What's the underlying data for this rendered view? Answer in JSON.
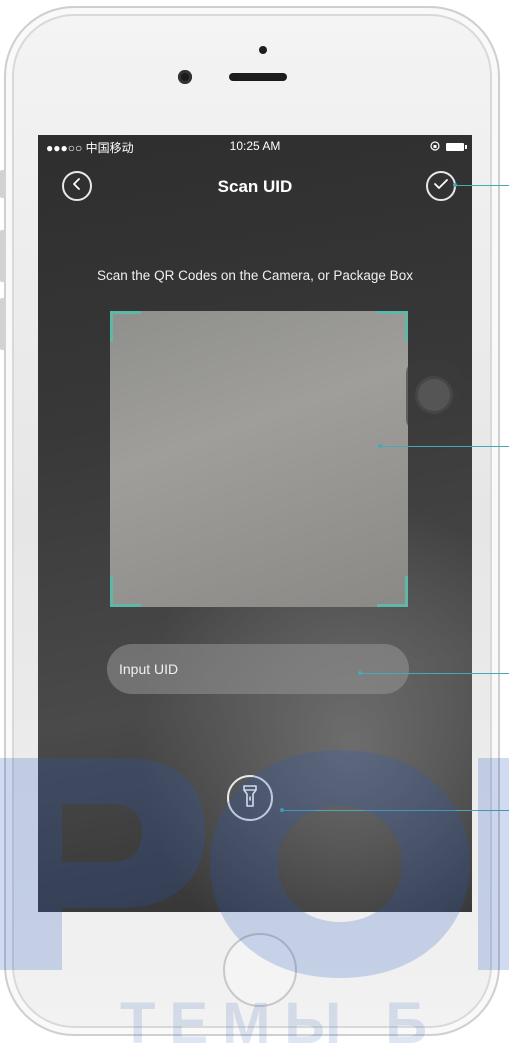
{
  "status_bar": {
    "carrier": "●●●○○ 中国移动",
    "time": "10:25 AM"
  },
  "navbar": {
    "title": "Scan UID",
    "back_icon": "chevron-left-icon",
    "confirm_icon": "checkmark-icon"
  },
  "instruction": "Scan the QR Codes on the Camera, or Package Box",
  "uid_input": {
    "placeholder": "Input UID",
    "value": ""
  },
  "flashlight": {
    "icon": "flashlight-icon"
  },
  "colors": {
    "accent": "#5fb7a8",
    "callout": "#4aa7b4",
    "screen_bg": "#3a3a3a"
  }
}
